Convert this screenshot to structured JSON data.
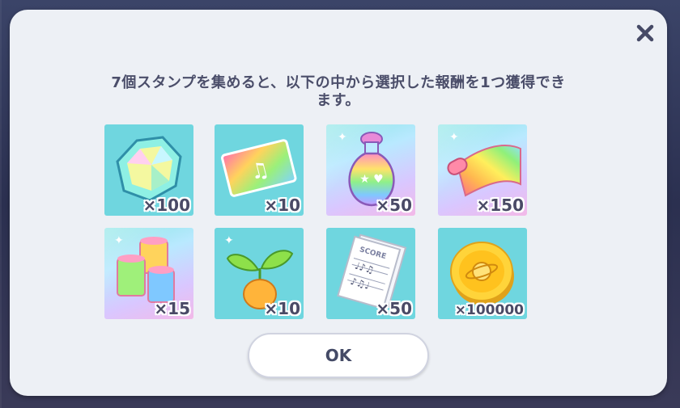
{
  "dialog": {
    "message_line1": "7個スタンプを集めると、以下の中から選択した報酬を1つ獲得でき",
    "message_line2": "ます。",
    "ok_label": "OK"
  },
  "rewards": [
    {
      "item": "crystal",
      "quantity": "×100"
    },
    {
      "item": "music-ticket",
      "quantity": "×10"
    },
    {
      "item": "rainbow-bottle",
      "quantity": "×50"
    },
    {
      "item": "rainbow-scroll",
      "quantity": "×150"
    },
    {
      "item": "thread-spools",
      "quantity": "×15"
    },
    {
      "item": "sprout-seed",
      "quantity": "×10"
    },
    {
      "item": "score-sheet",
      "quantity": "×50"
    },
    {
      "item": "gold-coin",
      "quantity": "×100000"
    }
  ],
  "colors": {
    "dialog_bg": "#edf0f5",
    "text": "#4b4e6a",
    "tile_plain": "#6fd6df"
  }
}
